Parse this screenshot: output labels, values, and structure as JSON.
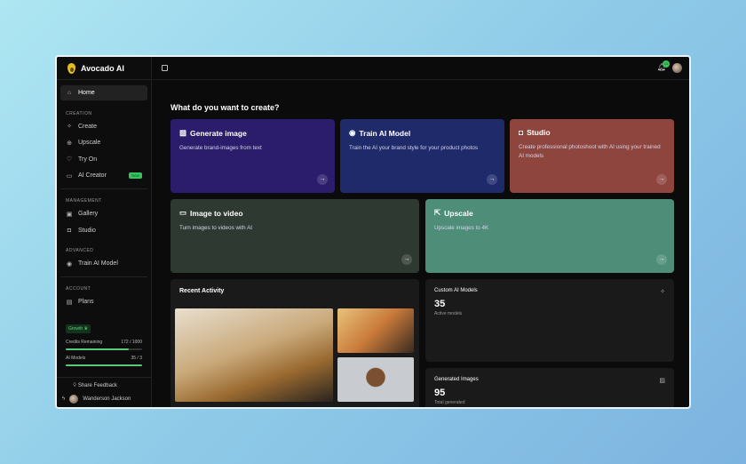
{
  "app": {
    "name": "Avocado AI"
  },
  "sidebar": {
    "home": "Home",
    "sections": {
      "creation": "CREATION",
      "management": "MANAGEMENT",
      "advanced": "ADVANCED",
      "account": "ACCOUNT"
    },
    "creation": [
      {
        "label": "Create",
        "icon": "sparkles-icon"
      },
      {
        "label": "Upscale",
        "icon": "zoom-icon"
      },
      {
        "label": "Try On",
        "icon": "shirt-icon"
      },
      {
        "label": "AI Creator",
        "icon": "video-icon",
        "badge": "New"
      }
    ],
    "management": [
      {
        "label": "Gallery",
        "icon": "gallery-icon"
      },
      {
        "label": "Studio",
        "icon": "camera-icon"
      }
    ],
    "advanced": [
      {
        "label": "Train AI Model",
        "icon": "brain-icon"
      }
    ],
    "account": [
      {
        "label": "Plans",
        "icon": "card-icon"
      }
    ],
    "plan": {
      "name": "Growth",
      "credits_label": "Credits Remaining",
      "credits_value": "172 / 1000",
      "credits_fraction": 0.83,
      "models_label": "AI Models",
      "models_value": "35 / 3",
      "models_fraction": 1.0
    },
    "feedback": "Share Feedback",
    "user": "Wanderson Jackson"
  },
  "topbar": {
    "notification_count": "10"
  },
  "main": {
    "heading": "What do you want to create?",
    "cards": [
      {
        "title": "Generate image",
        "desc": "Generate brand-images from text",
        "color": "#2b1d6b"
      },
      {
        "title": "Train AI Model",
        "desc": "Train the AI your brand style for your product photos",
        "color": "#1f2a6b"
      },
      {
        "title": "Studio",
        "desc": "Create professional photoshoot with AI using your trained AI models",
        "color": "#8e453e"
      },
      {
        "title": "Image to video",
        "desc": "Turn images to videos with AI",
        "color": "#2e3a31"
      },
      {
        "title": "Upscale",
        "desc": "Upscale images to 4K",
        "color": "#4e8e78"
      }
    ],
    "recent": "Recent Activity",
    "stats": [
      {
        "title": "Custom AI Models",
        "value": "35",
        "sub": "Active models"
      },
      {
        "title": "Generated Images",
        "value": "95",
        "sub": "Total generated"
      }
    ]
  }
}
